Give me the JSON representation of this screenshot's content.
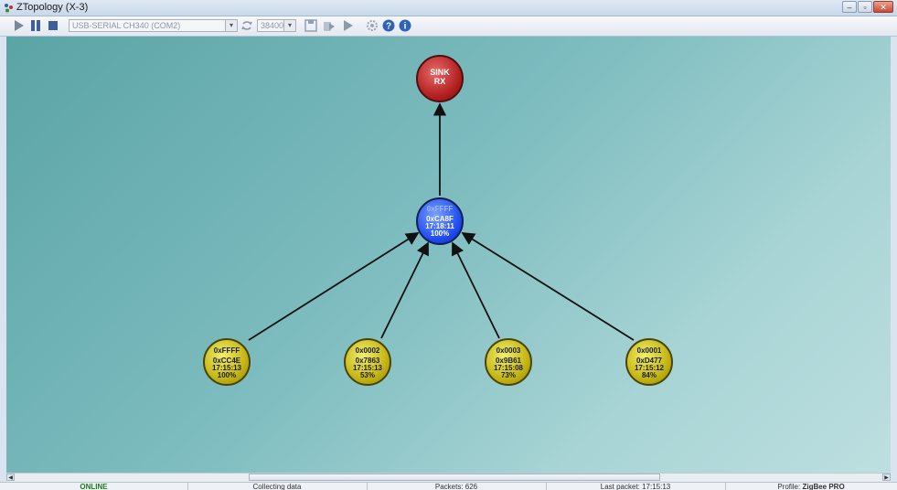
{
  "window": {
    "title": "ZTopology (X-3)"
  },
  "toolbar": {
    "port": "USB-SERIAL CH340 (COM2)",
    "baud": "38400"
  },
  "topology": {
    "sink": {
      "line1": "SINK",
      "line2": "RX"
    },
    "router": {
      "short_addr": "0xFFFF",
      "addr": "0xCA8F",
      "time": "17:18:11",
      "lqi": "100%"
    },
    "end_devices": [
      {
        "short_addr": "0xFFFF",
        "addr": "0xCC4E",
        "time": "17:15:13",
        "lqi": "100%"
      },
      {
        "short_addr": "0x0002",
        "addr": "0x7863",
        "time": "17:15:13",
        "lqi": "53%"
      },
      {
        "short_addr": "0x0003",
        "addr": "0x9B61",
        "time": "17:15:08",
        "lqi": "73%"
      },
      {
        "short_addr": "0x0001",
        "addr": "0xD477",
        "time": "17:15:12",
        "lqi": "84%"
      }
    ]
  },
  "status": {
    "state": "ONLINE",
    "activity": "Collecting data",
    "packets": "Packets: 626",
    "last_packet": "Last packet: 17:15:13",
    "profile_label": "Profile:",
    "profile_value": "ZigBee PRO"
  },
  "colors": {
    "sink": "#b01d1d",
    "router": "#1f49f0",
    "end_device": "#c3b514",
    "online": "#1a7d1a"
  }
}
